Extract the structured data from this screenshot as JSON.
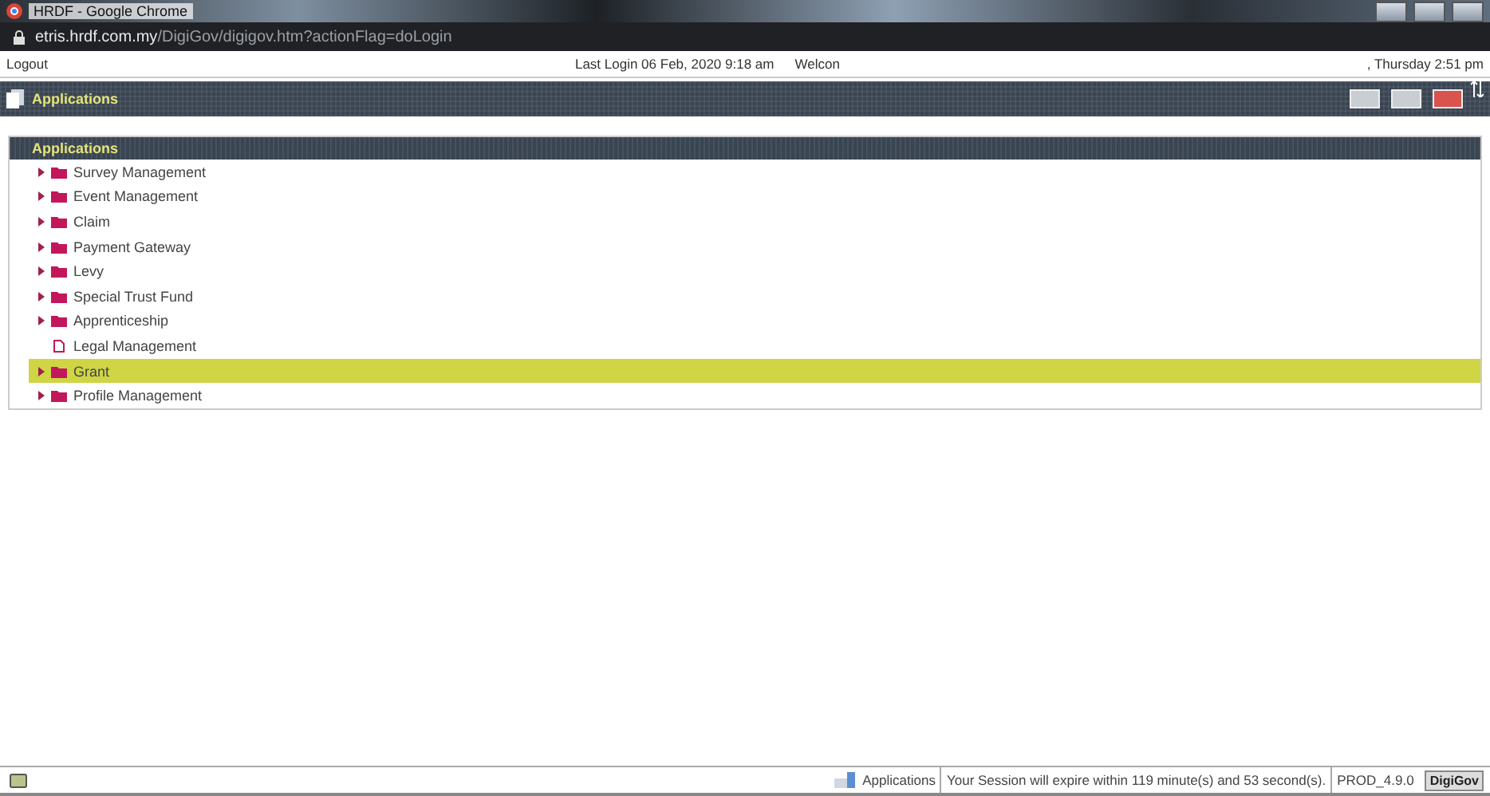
{
  "browser": {
    "title": "HRDF - Google Chrome",
    "url_host": "etris.hrdf.com.my",
    "url_path": "/DigiGov/digigov.htm?actionFlag=doLogin"
  },
  "info_bar": {
    "logout": "Logout",
    "last_login": "Last Login 06 Feb, 2020 9:18 am",
    "welcome": "Welcon",
    "datetime": ", Thursday 2:51 pm"
  },
  "app_header": {
    "title": "Applications"
  },
  "panel": {
    "title": "Applications",
    "items": [
      {
        "label": "Survey Management",
        "kind": "folder",
        "selected": false
      },
      {
        "label": "Event Management",
        "kind": "folder",
        "selected": false
      },
      {
        "label": "Claim",
        "kind": "folder",
        "selected": false
      },
      {
        "label": "Payment Gateway",
        "kind": "folder",
        "selected": false
      },
      {
        "label": "Levy",
        "kind": "folder",
        "selected": false
      },
      {
        "label": "Special Trust Fund",
        "kind": "folder",
        "selected": false
      },
      {
        "label": "Apprenticeship",
        "kind": "folder",
        "selected": false
      },
      {
        "label": "Legal Management",
        "kind": "document",
        "selected": false
      },
      {
        "label": "Grant",
        "kind": "folder",
        "selected": true
      },
      {
        "label": "Profile Management",
        "kind": "folder",
        "selected": false
      }
    ]
  },
  "status_bar": {
    "module": "Applications",
    "session": "Your Session will expire within 119 minute(s) and 53 second(s).",
    "version": "PROD_4.9.0",
    "brand": "DigiGov"
  }
}
